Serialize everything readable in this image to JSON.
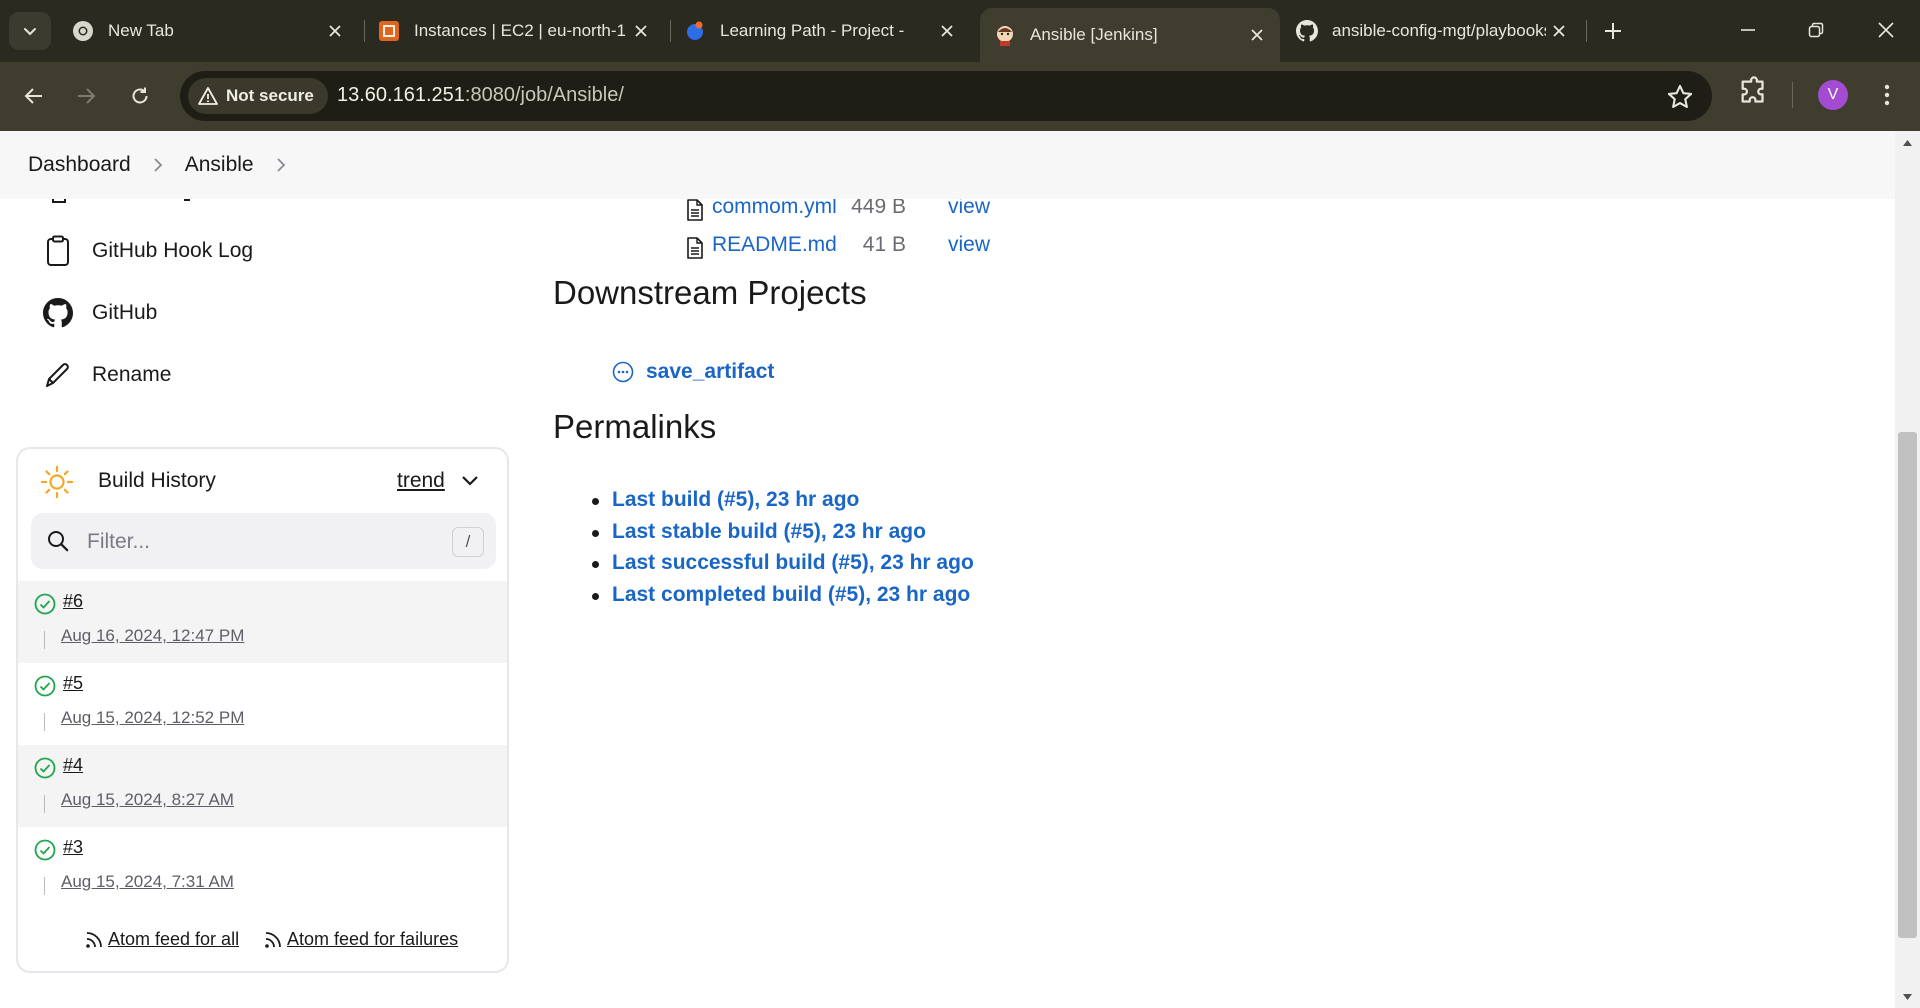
{
  "browser": {
    "tabs": [
      {
        "title": "New Tab",
        "favicon": "chrome-icon"
      },
      {
        "title": "Instances | EC2 | eu-north-1",
        "favicon": "aws-ec2-icon"
      },
      {
        "title": "Learning Path - Project -",
        "favicon": "darey-icon"
      },
      {
        "title": "Ansible [Jenkins]",
        "favicon": "jenkins-icon",
        "active": true
      },
      {
        "title": "ansible-config-mgt/playbooks",
        "favicon": "github-icon"
      }
    ],
    "security_label": "Not secure",
    "url_host": "13.60.161.251",
    "url_rest": ":8080/job/Ansible/",
    "profile_initial": "V",
    "colors": {
      "frame": "#2b2a20",
      "toolbar": "#3f3d2e",
      "avatar": "#a34bd1"
    }
  },
  "breadcrumb": {
    "items": [
      "Dashboard",
      "Ansible"
    ]
  },
  "sidebar": {
    "items": [
      {
        "label": "GitHub Hook Log",
        "icon": "clipboard-icon"
      },
      {
        "label": "GitHub",
        "icon": "github-icon"
      },
      {
        "label": "Rename",
        "icon": "pencil-icon"
      }
    ]
  },
  "build_history": {
    "title": "Build History",
    "trend_label": "trend",
    "filter_placeholder": "Filter...",
    "filter_shortcut": "/",
    "builds": [
      {
        "number": "#6",
        "date": "Aug 16, 2024, 12:47 PM",
        "status": "success"
      },
      {
        "number": "#5",
        "date": "Aug 15, 2024, 12:52 PM",
        "status": "success"
      },
      {
        "number": "#4",
        "date": "Aug 15, 2024, 8:27 AM",
        "status": "success"
      },
      {
        "number": "#3",
        "date": "Aug 15, 2024, 7:31 AM",
        "status": "success"
      }
    ],
    "feed_all": "Atom feed for all",
    "feed_failures": "Atom feed for failures"
  },
  "artifacts": {
    "files": [
      {
        "name": "commom.yml",
        "size": "449 B",
        "action": "view"
      },
      {
        "name": "README.md",
        "size": "41 B",
        "action": "view"
      }
    ]
  },
  "downstream": {
    "heading": "Downstream Projects",
    "project": "save_artifact"
  },
  "permalinks": {
    "heading": "Permalinks",
    "items": [
      "Last build (#5), 23 hr ago",
      "Last stable build (#5), 23 hr ago",
      "Last successful build (#5), 23 hr ago",
      "Last completed build (#5), 23 hr ago"
    ]
  },
  "colors": {
    "link": "#1a66c7",
    "success": "#1ea64b",
    "sun": "#f5a623"
  }
}
